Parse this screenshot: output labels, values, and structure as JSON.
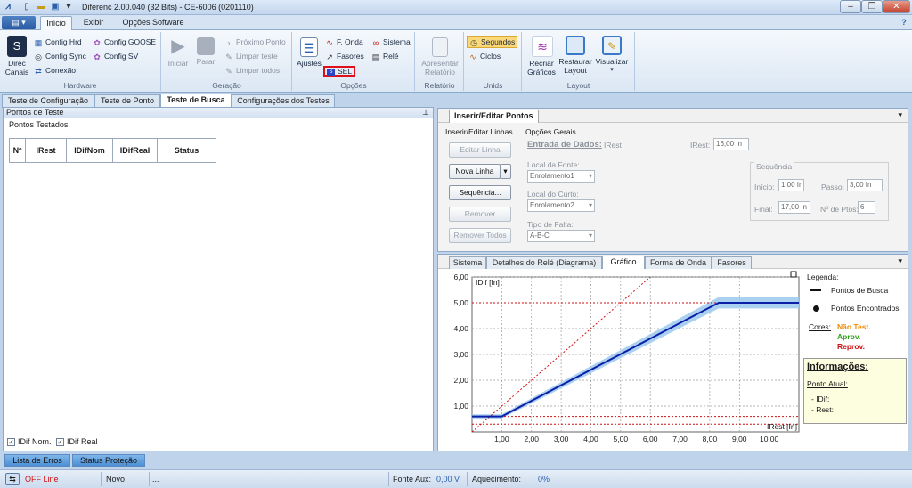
{
  "window": {
    "title": "Diferenc 2.00.040 (32 Bits) - CE-6006 (0201110)"
  },
  "ribbon_tabs": [
    "Início",
    "Exibir",
    "Opções Software"
  ],
  "ribbon": {
    "hardware": {
      "label": "Hardware",
      "direc": "Direc\nCanais",
      "config_hrd": "Config Hrd",
      "config_sync": "Config Sync",
      "conexao": "Conexão",
      "config_goose": "Config GOOSE",
      "config_sv": "Config SV"
    },
    "geracao": {
      "label": "Geração",
      "iniciar": "Iniciar",
      "parar": "Parar",
      "proximo": "Próximo Ponto",
      "limpar_teste": "Limpar teste",
      "limpar_todos": "Limpar todos"
    },
    "opcoes": {
      "label": "Opções",
      "ajustes": "Ajustes",
      "fonda": "F. Onda",
      "sistema": "Sistema",
      "fasores": "Fasores",
      "rele": "Relé",
      "sel": "SEL"
    },
    "relatorio": {
      "label": "Relatório",
      "apresentar": "Apresentar Relatório"
    },
    "unids": {
      "label": "Unids",
      "segundos": "Segundos",
      "ciclos": "Ciclos"
    },
    "layout": {
      "label": "Layout",
      "recriar": "Recriar Gráficos",
      "restaurar": "Restaurar Layout",
      "visualizar": "Visualizar"
    }
  },
  "doc_tabs": [
    "Teste de Configuração",
    "Teste de Ponto",
    "Teste de Busca",
    "Configurações dos Testes"
  ],
  "left": {
    "header": "Pontos de Teste",
    "sub": "Pontos Testados",
    "columns": [
      "Nº",
      "IRest",
      "IDifNom",
      "IDifReal",
      "Status"
    ],
    "chk_nom": "IDif Nom.",
    "chk_real": "IDif Real",
    "bottom_tabs": [
      "Lista de Erros",
      "Status Proteção"
    ]
  },
  "insert": {
    "header": "Inserir/Editar Pontos",
    "group_lines": "Inserir/Editar Linhas",
    "editar": "Editar Linha",
    "nova": "Nova Linha",
    "sequencia": "Sequência...",
    "remover": "Remover",
    "remover_todos": "Remover Todos",
    "opcoes_gerais": "Opções Gerais",
    "entrada": "Entrada de Dados:",
    "entrada_val": "IRest",
    "irest_lbl": "IRest:",
    "irest_val": "16,00 In",
    "local_fonte": "Local da Fonte:",
    "fonte_val": "Enrolamento1",
    "local_curto": "Local do Curto:",
    "curto_val": "Enrolamento2",
    "tipo_falta": "Tipo de Falta:",
    "falta_val": "A-B-C",
    "seq_title": "Sequência",
    "inicio": "Início:",
    "inicio_val": "1,00 In",
    "passo": "Passo:",
    "passo_val": "3,00 In",
    "final": "Final:",
    "final_val": "17,00 In",
    "npts": "Nº de Ptos:",
    "npts_val": "6"
  },
  "graph_tabs": [
    "Sistema",
    "Detalhes do Relé (Diagrama)",
    "Gráfico",
    "Forma de Onda",
    "Fasores"
  ],
  "legend": {
    "title": "Legenda:",
    "busca": "Pontos de Busca",
    "encontrados": "Pontos Encontrados",
    "cores": "Cores:",
    "nao_test": "Não Test.",
    "aprov": "Aprov.",
    "reprov": "Reprov."
  },
  "info": {
    "title": "Informações:",
    "ponto": "Ponto Atual:",
    "idif": "- IDif:",
    "rest": "- Rest:"
  },
  "colors": {
    "nao_test": "#f08a00",
    "aprov": "#2e9e1a",
    "reprov": "#d01010",
    "curve": "#0b1fa8",
    "band": "#9cc9ee"
  },
  "chart_data": {
    "type": "line",
    "xlabel": "IRest [In]",
    "ylabel": "IDif [In]",
    "xlim": [
      0,
      11
    ],
    "ylim": [
      0,
      6
    ],
    "xticks": [
      "1,00",
      "2,00",
      "3,00",
      "4,00",
      "5,00",
      "6,00",
      "7,00",
      "8,00",
      "9,00",
      "10,00"
    ],
    "yticks": [
      "1,00",
      "2,00",
      "3,00",
      "4,00",
      "5,00",
      "6,00"
    ],
    "series": [
      {
        "x": [
          0,
          1,
          8.3,
          11
        ],
        "y": [
          0.6,
          0.6,
          5.0,
          5.0
        ]
      },
      {
        "x": [
          0,
          6
        ],
        "y": [
          0,
          6
        ]
      }
    ],
    "limits": [
      0.3,
      0.6,
      5.0
    ]
  },
  "status": {
    "mode": "OFF Line",
    "file": "Novo",
    "dots": "...",
    "fonte_lbl": "Fonte Aux:",
    "fonte_val": "0,00 V",
    "aquec_lbl": "Aquecimento:",
    "aquec_val": "0%"
  }
}
